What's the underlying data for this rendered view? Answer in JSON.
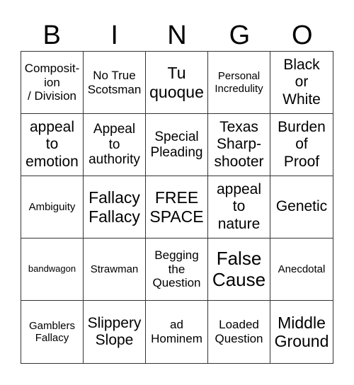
{
  "header": [
    "B",
    "I",
    "N",
    "G",
    "O"
  ],
  "cells": [
    "Composit-\nion\n/ Division",
    "No True\nScotsman",
    "Tu\nquoque",
    "Personal\nIncredulity",
    "Black\nor\nWhite",
    "appeal\nto\nemotion",
    "Appeal\nto\nauthority",
    "Special\nPleading",
    "Texas\nSharp-\nshooter",
    "Burden\nof\nProof",
    "Ambiguity",
    "Fallacy\nFallacy",
    "FREE\nSPACE",
    "appeal\nto\nnature",
    "Genetic",
    "bandwagon",
    "Strawman",
    "Begging\nthe\nQuestion",
    "False\nCause",
    "Anecdotal",
    "Gamblers\nFallacy",
    "Slippery\nSlope",
    "ad\nHominem",
    "Loaded\nQuestion",
    "Middle\nGround"
  ]
}
